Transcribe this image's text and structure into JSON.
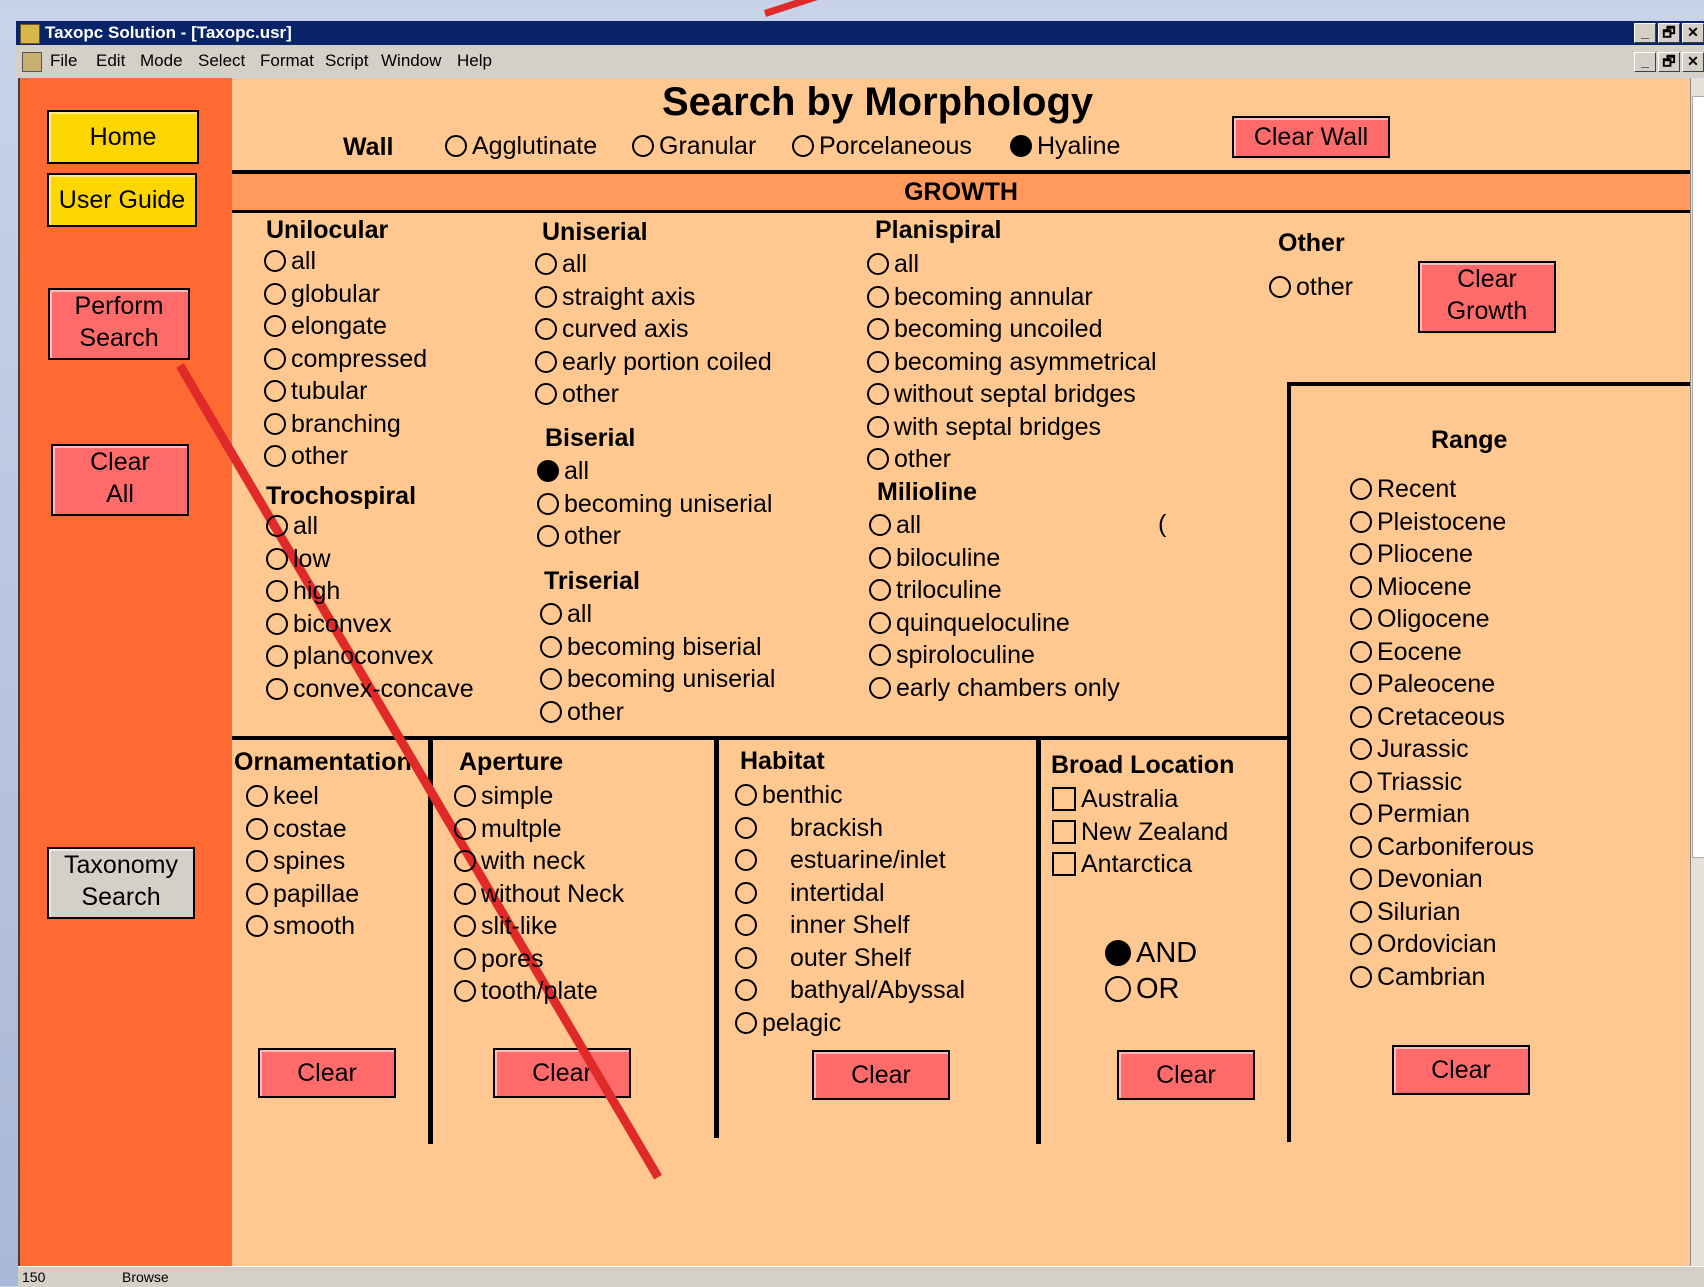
{
  "window": {
    "title": "Taxopc Solution - [Taxopc.usr]",
    "buttons": [
      "_",
      "🗗",
      "✕"
    ]
  },
  "menu": [
    "File",
    "Edit",
    "Mode",
    "Select",
    "Format",
    "Script",
    "Window",
    "Help"
  ],
  "sidebar": {
    "home": "Home",
    "guide": "User Guide",
    "perform1": "Perform",
    "perform2": "Search",
    "clearall1": "Clear",
    "clearall2": "All",
    "tax1": "Taxonomy",
    "tax2": "Search"
  },
  "header": {
    "title": "Search by Morphology",
    "wall_label": "Wall",
    "wall_options": [
      "Agglutinate",
      "Granular",
      "Porcelaneous",
      "Hyaline"
    ],
    "wall_selected": "Hyaline",
    "clear_wall": "Clear  Wall"
  },
  "growth": {
    "label": "GROWTH",
    "clear1": "Clear",
    "clear2": "Growth",
    "unilocular": {
      "title": "Unilocular",
      "options": [
        "all",
        "globular",
        "elongate",
        "compressed",
        "tubular",
        "branching",
        "other"
      ]
    },
    "trochospiral": {
      "title": "Trochospiral",
      "options": [
        "all",
        "low",
        "high",
        "biconvex",
        "planoconvex",
        "convex-concave"
      ]
    },
    "uniserial": {
      "title": "Uniserial",
      "options": [
        "all",
        "straight axis",
        "curved axis",
        "early portion coiled",
        "other"
      ]
    },
    "biserial": {
      "title": "Biserial",
      "options": [
        "all",
        "becoming uniserial",
        "other"
      ],
      "selected": "all"
    },
    "triserial": {
      "title": "Triserial",
      "options": [
        "all",
        "becoming biserial",
        "becoming uniserial",
        "other"
      ]
    },
    "planispiral": {
      "title": "Planispiral",
      "options": [
        "all",
        "becoming annular",
        "becoming uncoiled",
        "becoming asymmetrical",
        "without septal bridges",
        "with septal bridges",
        "other"
      ]
    },
    "milioline": {
      "title": "Milioline",
      "options": [
        "all",
        "biloculine",
        "triloculine",
        "quinqueloculine",
        "spiroloculine",
        "early chambers only"
      ]
    },
    "other": {
      "title": "Other",
      "options": [
        "other"
      ]
    },
    "stray_glyph": "("
  },
  "range": {
    "title": "Range",
    "options": [
      "Recent",
      "Pleistocene",
      "Pliocene",
      "Miocene",
      "Oligocene",
      "Eocene",
      "Paleocene",
      "Cretaceous",
      "Jurassic",
      "Triassic",
      "Permian",
      "Carboniferous",
      "Devonian",
      "Silurian",
      "Ordovician",
      "Cambrian"
    ],
    "clear": "Clear"
  },
  "ornamentation": {
    "title": "Ornamentation",
    "options": [
      "keel",
      "costae",
      "spines",
      "papillae",
      "smooth"
    ],
    "clear": "Clear"
  },
  "aperture": {
    "title": "Aperture",
    "options": [
      "simple",
      "multple",
      "with neck",
      "without Neck",
      "slit-like",
      "pores",
      "tooth/plate"
    ],
    "clear": "Clear"
  },
  "habitat": {
    "title": "Habitat",
    "options": [
      "benthic",
      "brackish",
      "estuarine/inlet",
      "intertidal",
      "inner Shelf",
      "outer Shelf",
      "bathyal/Abyssal",
      "pelagic"
    ],
    "clear": "Clear"
  },
  "location": {
    "title": "Broad Location",
    "options": [
      "Australia",
      "New Zealand",
      "Antarctica"
    ],
    "logic": [
      "AND",
      "OR"
    ],
    "logic_selected": "AND",
    "clear": "Clear"
  },
  "status": {
    "zoom": "150",
    "mode": "Browse"
  },
  "annotation_color": "#e02a2a"
}
